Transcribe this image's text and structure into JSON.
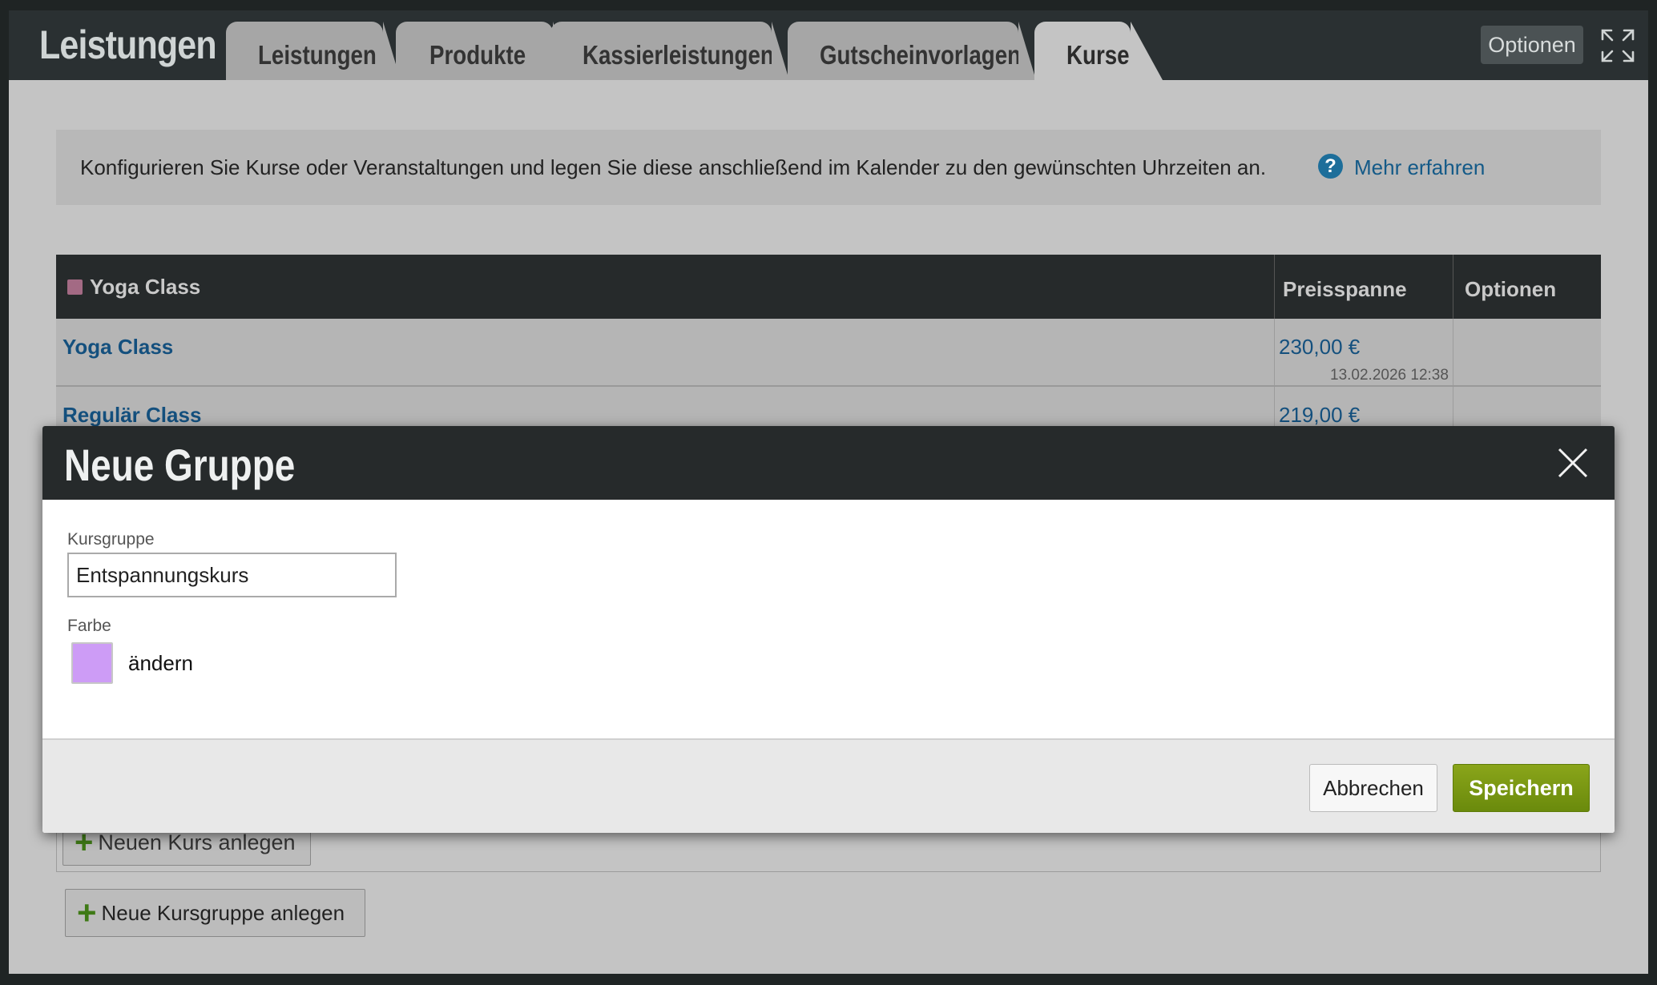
{
  "header": {
    "app_title": "Leistungen",
    "tabs": [
      {
        "label": "Leistungen"
      },
      {
        "label": "Produkte"
      },
      {
        "label": "Kassierleistungen"
      },
      {
        "label": "Gutscheinvorlagen"
      },
      {
        "label": "Kurse"
      }
    ],
    "active_tab": "Kurse",
    "options_label": "Optionen",
    "fullscreen_icon": "fullscreen-icon"
  },
  "info": {
    "text": "Konfigurieren Sie Kurse oder Veranstaltungen und legen Sie diese anschließend im Kalender zu den gewünschten Uhrzeiten an.",
    "link": "Mehr erfahren",
    "icon": "help-icon"
  },
  "table": {
    "group_name": "Yoga Class",
    "group_color": "#a36a84",
    "columns": {
      "price": "Preisspanne",
      "options": "Optionen"
    },
    "rows": [
      {
        "name": "Yoga Class",
        "price": "230,00 €",
        "date": "13.02.2026 12:38"
      },
      {
        "name": "Regulär Class",
        "price": "219,00 €",
        "date": ""
      }
    ]
  },
  "buttons": {
    "new_course": "Neuen Kurs anlegen",
    "new_course_group": "Neue Kursgruppe anlegen"
  },
  "modal": {
    "title": "Neue Gruppe",
    "close_icon": "close-icon",
    "field_label": "Kursgruppe",
    "field_value": "Entspannungskurs",
    "color_label": "Farbe",
    "color_value": "#cd9cf6",
    "change_label": "ändern",
    "cancel_label": "Abbrechen",
    "save_label": "Speichern",
    "save_color": "#7a9a14"
  }
}
